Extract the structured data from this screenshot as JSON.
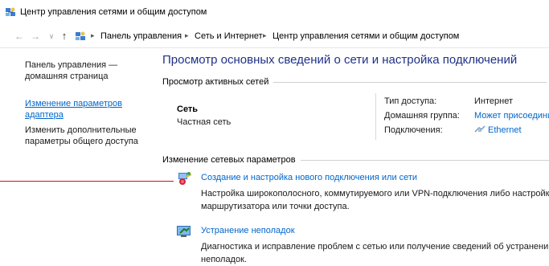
{
  "window": {
    "title": "Центр управления сетями и общим доступом"
  },
  "addressbar": {
    "crumbs": [
      "Панель управления",
      "Сеть и Интернет",
      "Центр управления сетями и общим доступом"
    ]
  },
  "sidebar": {
    "home": "Панель управления — домашняя страница",
    "adapter": "Изменение параметров адаптера",
    "sharing": "Изменить дополнительные параметры общего доступа"
  },
  "main": {
    "title": "Просмотр основных сведений о сети и настройка подключений",
    "active_networks_heading": "Просмотр активных сетей",
    "network": {
      "name": "Сеть",
      "type": "Частная сеть",
      "access_type_label": "Тип доступа:",
      "access_type_value": "Интернет",
      "homegroup_label": "Домашняя группа:",
      "homegroup_value": "Может присоедини",
      "connections_label": "Подключения:",
      "connections_value": "Ethernet"
    },
    "change_settings_heading": "Изменение сетевых параметров",
    "tasks": [
      {
        "title": "Создание и настройка нового подключения или сети",
        "description": "Настройка широкополосного, коммутируемого или VPN-подключения либо настройка маршрутизатора или точки доступа.",
        "icon": "new-connection-icon"
      },
      {
        "title": "Устранение неполадок",
        "description": "Диагностика и исправление проблем с сетью или получение сведений об устранении неполадок.",
        "icon": "troubleshoot-icon"
      }
    ]
  },
  "colors": {
    "link": "#0066cc",
    "title": "#1e3287",
    "annotation_line": "#d01010"
  }
}
